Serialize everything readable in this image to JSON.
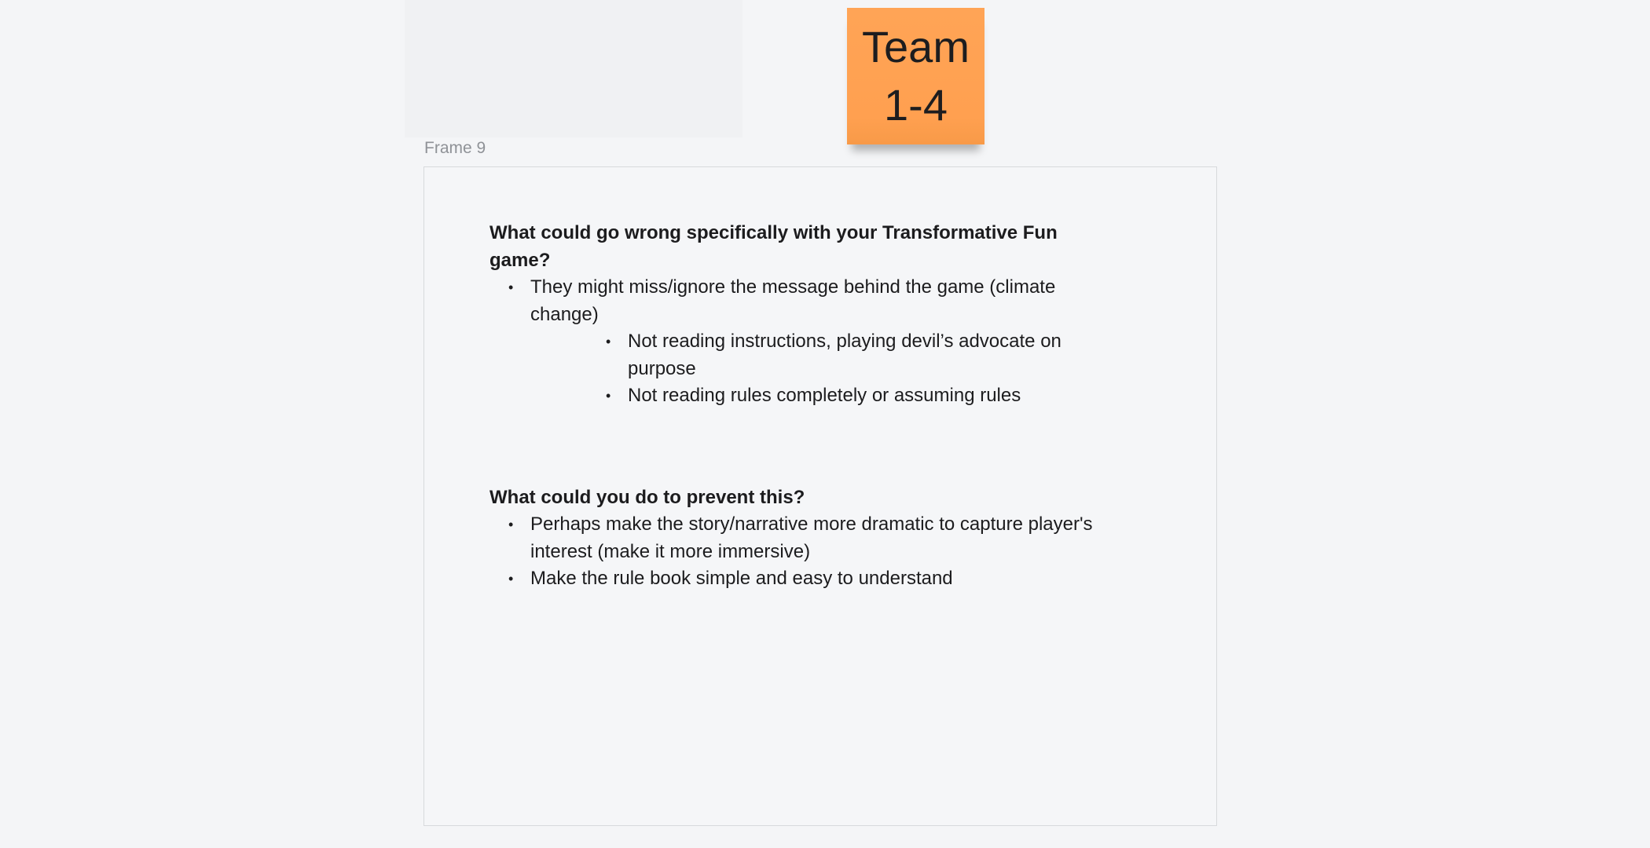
{
  "frame": {
    "label": "Frame 9"
  },
  "sticky_note": {
    "line1": "Team",
    "line2": "1-4",
    "color": "#ffa456"
  },
  "section1": {
    "heading": "What could go wrong specifically with your Transformative Fun game?",
    "bullet": "They might miss/ignore the message behind the game (climate change)",
    "sub_bullets": [
      "Not reading instructions, playing devil’s advocate on purpose",
      "Not reading rules completely or assuming rules"
    ]
  },
  "section2": {
    "heading": "What could you do to prevent this?",
    "bullets": [
      "Perhaps make the story/narrative more dramatic to capture player's interest (make it more immersive)",
      "Make the rule book simple and easy to understand"
    ]
  }
}
